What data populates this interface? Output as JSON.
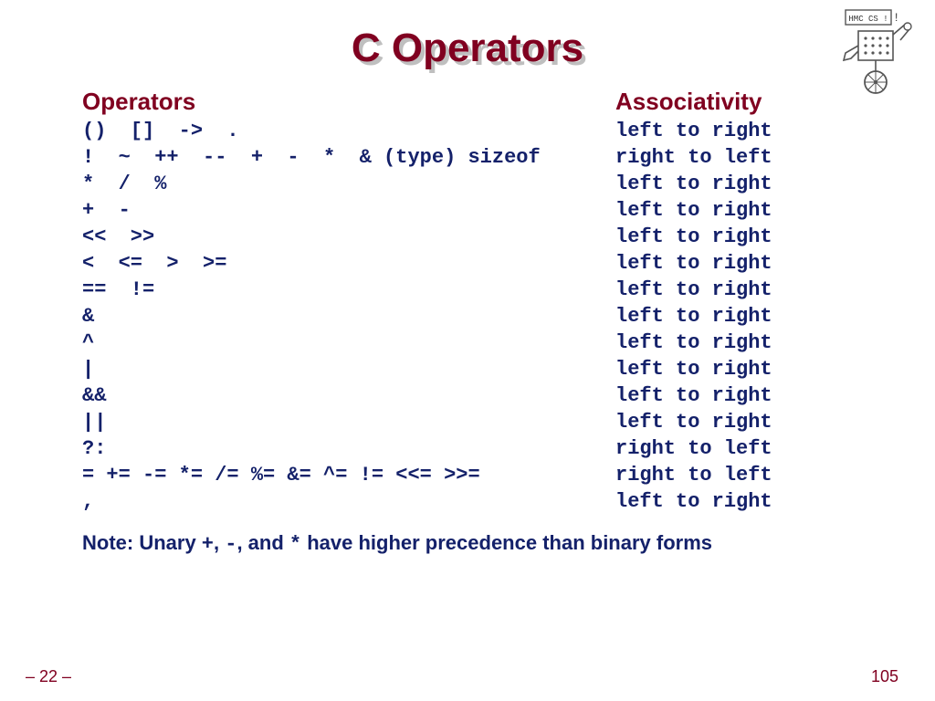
{
  "title": "C Operators",
  "headers": {
    "operators": "Operators",
    "associativity": "Associativity"
  },
  "rows": [
    {
      "ops": "()  []  ->  .",
      "assoc": "left to right"
    },
    {
      "ops": "!  ~  ++  --  +  -  *  & (type) sizeof",
      "assoc": "right to left"
    },
    {
      "ops": "*  /  %",
      "assoc": "left to right"
    },
    {
      "ops": "+  -",
      "assoc": "left to right"
    },
    {
      "ops": "<<  >>",
      "assoc": "left to right"
    },
    {
      "ops": "<  <=  >  >=",
      "assoc": "left to right"
    },
    {
      "ops": "==  !=",
      "assoc": "left to right"
    },
    {
      "ops": "&",
      "assoc": "left to right"
    },
    {
      "ops": "^",
      "assoc": "left to right"
    },
    {
      "ops": "|",
      "assoc": "left to right"
    },
    {
      "ops": "&&",
      "assoc": "left to right"
    },
    {
      "ops": "||",
      "assoc": "left to right"
    },
    {
      "ops": "?:",
      "assoc": "right to left"
    },
    {
      "ops": "= += -= *= /= %= &= ^= != <<= >>=",
      "assoc": "right to left"
    },
    {
      "ops": ",",
      "assoc": "left to right"
    }
  ],
  "note_parts": {
    "p1": "Note: Unary ",
    "m1": "+",
    "p2": ", ",
    "m2": "-",
    "p3": ", and ",
    "m3": "*",
    "p4": " have higher precedence than binary forms"
  },
  "footer": {
    "left": "– 22 –",
    "right": "105"
  },
  "logo": {
    "text": "HMC  CS !"
  }
}
